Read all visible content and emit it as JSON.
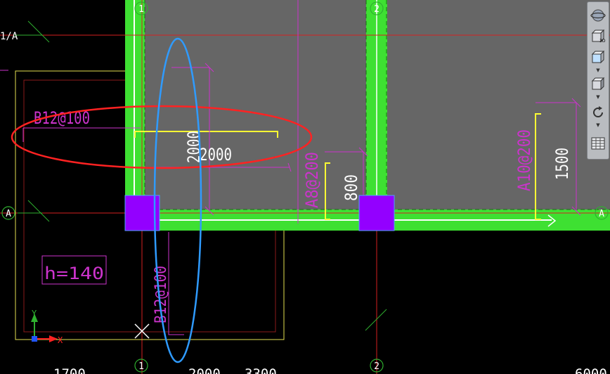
{
  "colors": {
    "background": "#000000",
    "slab": "#666666",
    "beam": "#3ee032",
    "column": "#9300ff",
    "magenta": "#cc33cc",
    "red_axis": "#d42121",
    "yellow": "#ffff33",
    "annotation_red": "#ff2222",
    "annotation_blue": "#2f9bff",
    "white": "#ffffff"
  },
  "axis_bubbles": {
    "top_1": "1",
    "top_2": "2",
    "bottom_1": "1",
    "bottom_2": "2",
    "left_A": "A",
    "right_A": "A",
    "left_1A": "1/A"
  },
  "labels": {
    "rebar_b12_top": "B12@100",
    "rebar_b12_vertical": "B12@100",
    "dim_2000_a": "2000",
    "dim_2000_b": "2000",
    "rebar_a8": "A8@200",
    "dim_800": "800",
    "rebar_a10": "A10@200",
    "dim_1500": "1500",
    "slab_thickness": "h=140",
    "bottom_dim_1700": "1700",
    "bottom_dim_2000": "2000",
    "bottom_dim_3300": "3300",
    "bottom_dim_6000": "6000"
  },
  "ucs": {
    "x_label": "X",
    "y_label": "Y"
  },
  "toolbar": {
    "buttons": [
      "orbit-icon",
      "3d-box-icon",
      "cube-front-icon",
      "cube-view-icon",
      "rotate-icon",
      "grid-table-icon"
    ]
  }
}
